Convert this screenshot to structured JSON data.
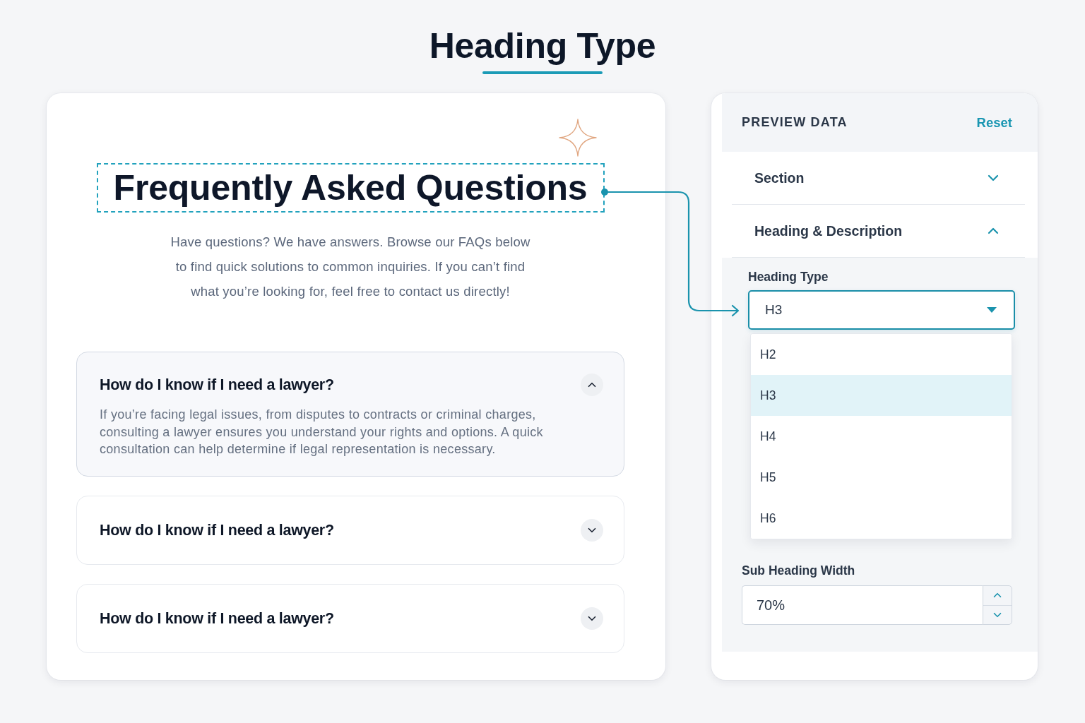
{
  "page_title": "Heading Type",
  "preview": {
    "heading": "Frequently Asked Questions",
    "description": "Have questions? We have answers. Browse our FAQs below to find quick solutions to common inquiries. If you can’t find what you’re looking for, feel free to contact us directly!",
    "faqs": [
      {
        "question": "How do I know if I need a lawyer?",
        "answer": "If you’re facing legal issues, from disputes to contracts or criminal charges, consulting a lawyer ensures you understand your rights and options. A quick consultation can help determine if legal representation is necessary.",
        "expanded": true
      },
      {
        "question": "How do I know if I need a lawyer?",
        "expanded": false
      },
      {
        "question": "How do I know if I need a lawyer?",
        "expanded": false
      }
    ]
  },
  "panel": {
    "title": "PREVIEW DATA",
    "reset": "Reset",
    "sections": [
      {
        "label": "Section",
        "expanded": false
      },
      {
        "label": "Heading & Description",
        "expanded": true
      }
    ],
    "heading_type": {
      "label": "Heading Type",
      "value": "H3",
      "options": [
        {
          "label": "H2",
          "selected": false
        },
        {
          "label": "H3",
          "selected": true
        },
        {
          "label": "H4",
          "selected": false
        },
        {
          "label": "H5",
          "selected": false
        },
        {
          "label": "H6",
          "selected": false
        }
      ]
    },
    "sub_heading_width": {
      "label": "Sub Heading Width",
      "value": "70%"
    }
  }
}
